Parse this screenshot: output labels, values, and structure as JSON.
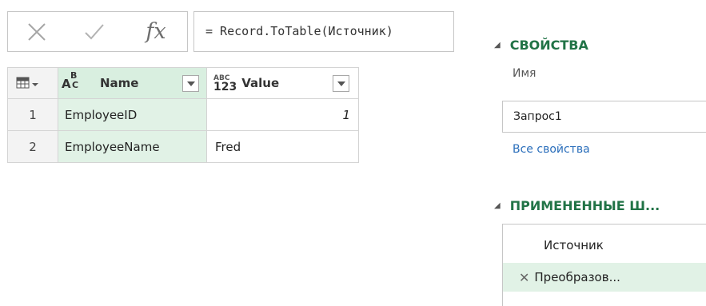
{
  "formula_bar": {
    "cancel_icon": "close-icon",
    "confirm_icon": "check-icon",
    "fx_label": "fx",
    "formula": "= Record.ToTable(Источник)"
  },
  "grid": {
    "columns": [
      {
        "type_label": "ABC",
        "title": "Name"
      },
      {
        "type_label": "ABC 123",
        "title": "Value"
      }
    ],
    "rows": [
      {
        "num": "1",
        "name": "EmployeeID",
        "value": "1"
      },
      {
        "num": "2",
        "name": "EmployeeName",
        "value": "Fred"
      }
    ]
  },
  "properties": {
    "title": "СВОЙСТВА",
    "name_label": "Имя",
    "name_value": "Запрос1",
    "all_props_link": "Все свойства"
  },
  "applied_steps": {
    "title": "ПРИМЕНЕННЫЕ Ш...",
    "steps": [
      "Источник",
      "Преобразов..."
    ]
  },
  "colors": {
    "accent_green": "#217346",
    "selected_row": "#e1f2e6",
    "link_blue": "#2a6ebb"
  }
}
